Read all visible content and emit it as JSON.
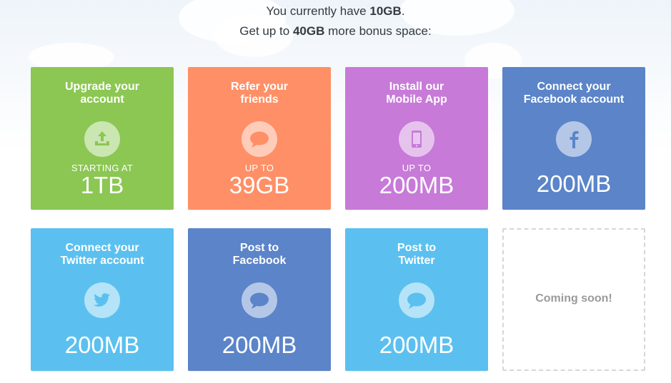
{
  "header": {
    "line1_prefix": "You currently have ",
    "line1_amount": "10GB",
    "line1_suffix": ".",
    "line2_prefix": "Get up to ",
    "line2_amount": "40GB",
    "line2_suffix": " more bonus space:"
  },
  "cards": [
    {
      "title": [
        "Upgrade your",
        "account"
      ],
      "prefix": "STARTING AT",
      "value": "1TB",
      "color": "#8bc752",
      "icon": "upload-tray-icon"
    },
    {
      "title": [
        "Refer your",
        "friends"
      ],
      "prefix": "UP TO",
      "value": "39GB",
      "color": "#ff8f66",
      "icon": "speech-bubble-icon"
    },
    {
      "title": [
        "Install our",
        "Mobile App"
      ],
      "prefix": "UP TO",
      "value": "200MB",
      "color": "#c77ad8",
      "icon": "mobile-phone-icon"
    },
    {
      "title": [
        "Connect your",
        "Facebook account"
      ],
      "prefix": "",
      "value": "200MB",
      "color": "#5b84c9",
      "icon": "facebook-icon"
    },
    {
      "title": [
        "Connect your",
        "Twitter account"
      ],
      "prefix": "",
      "value": "200MB",
      "color": "#5bc0ef",
      "icon": "twitter-bird-icon"
    },
    {
      "title": [
        "Post to",
        "Facebook"
      ],
      "prefix": "",
      "value": "200MB",
      "color": "#5b84c9",
      "icon": "speech-bubble-icon"
    },
    {
      "title": [
        "Post to",
        "Twitter"
      ],
      "prefix": "",
      "value": "200MB",
      "color": "#5bc0ef",
      "icon": "speech-bubble-icon"
    }
  ],
  "coming_soon": "Coming soon!"
}
